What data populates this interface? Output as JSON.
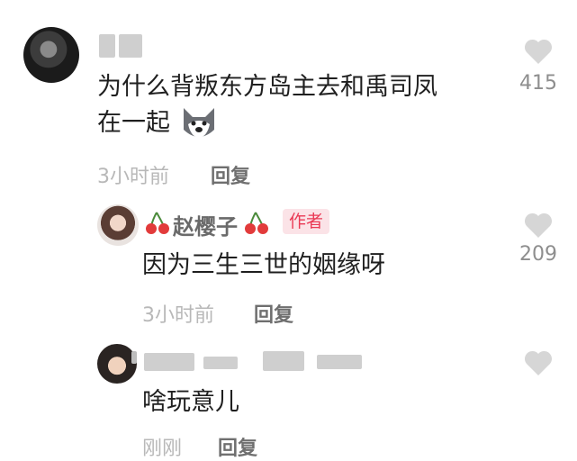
{
  "comments": [
    {
      "text_line1": "为什么背叛东方岛主去和禹司凤",
      "text_line2": "在一起",
      "emoji": "husky-emoji",
      "time": "3小时前",
      "reply": "回复",
      "likes": "415"
    },
    {
      "username": "赵樱子",
      "badge": "作者",
      "text": "因为三生三世的姻缘呀",
      "time": "3小时前",
      "reply": "回复",
      "likes": "209"
    },
    {
      "text": "啥玩意儿",
      "time": "刚刚",
      "reply": "回复"
    }
  ],
  "icons": {
    "like": "heart-icon",
    "decoration": "cherry-icon"
  },
  "colors": {
    "heart": "#d6d6d6",
    "badge_bg": "#fbe3e7",
    "badge_text": "#ea3a55",
    "cherry": "#e23b3b"
  }
}
